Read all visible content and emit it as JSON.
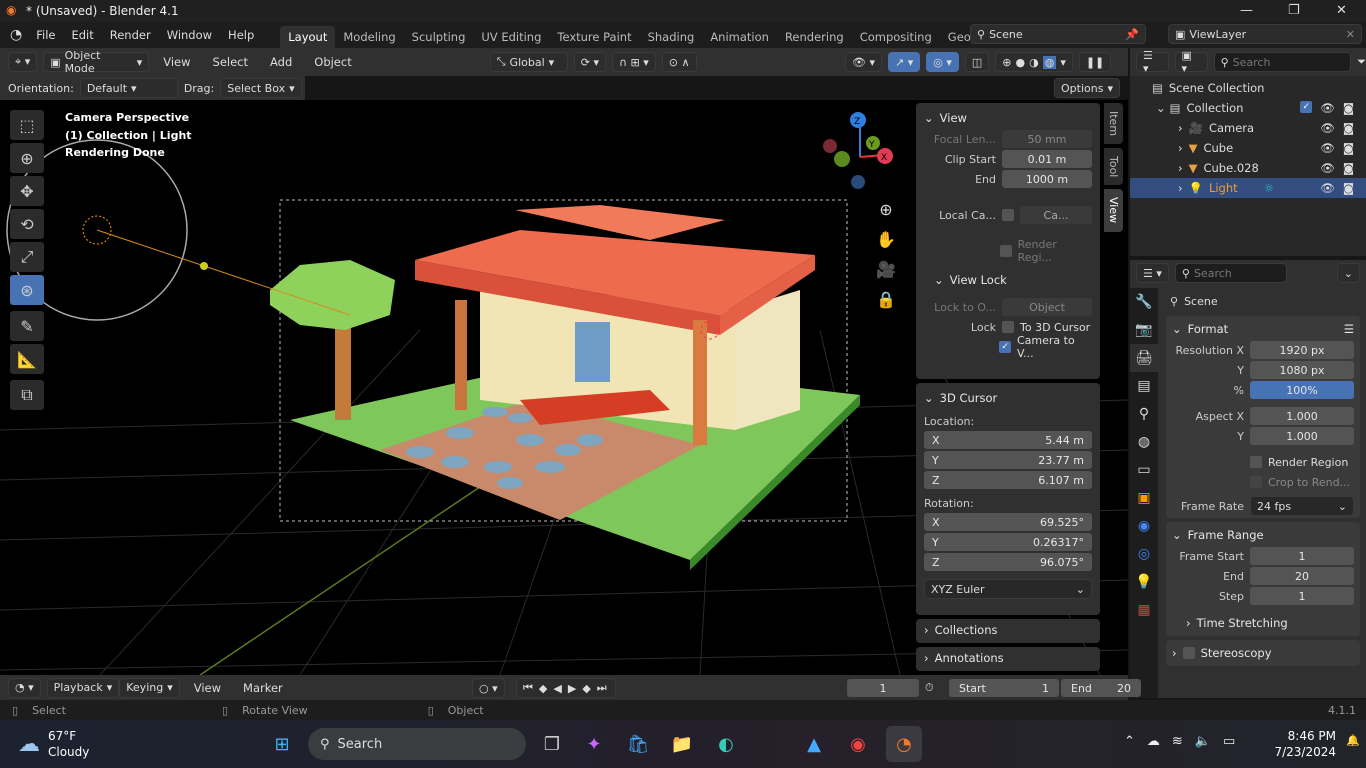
{
  "window": {
    "title": "* (Unsaved) - Blender 4.1"
  },
  "menus": [
    "File",
    "Edit",
    "Render",
    "Window",
    "Help"
  ],
  "workspaces": [
    "Layout",
    "Modeling",
    "Sculpting",
    "UV Editing",
    "Texture Paint",
    "Shading",
    "Animation",
    "Rendering",
    "Compositing",
    "Geomet"
  ],
  "scene": {
    "name": "Scene",
    "view_layer": "ViewLayer"
  },
  "header": {
    "mode": "Object Mode",
    "menus": [
      "View",
      "Select",
      "Add",
      "Object"
    ],
    "transform_orientation": "Global"
  },
  "tool_settings": {
    "orientation_label": "Orientation:",
    "orientation": "Default",
    "drag_label": "Drag:",
    "drag": "Select Box",
    "options": "Options"
  },
  "viewport": {
    "overlay_lines": [
      "Camera Perspective",
      "(1) Collection | Light",
      "Rendering Done"
    ],
    "gizmo_axes": [
      "X",
      "Y",
      "Z"
    ]
  },
  "npanel": {
    "tabs": [
      "Item",
      "Tool",
      "View"
    ],
    "view": {
      "title": "View",
      "focal_label": "Focal Len...",
      "focal": "50 mm",
      "clip_start_label": "Clip Start",
      "clip_start": "0.01 m",
      "end_label": "End",
      "end": "1000 m",
      "local_camera_label": "Local Ca...",
      "local_camera": "Ca...",
      "render_region": "Render Regi...",
      "view_lock": "View Lock",
      "lock_to_label": "Lock to O...",
      "lock_to": "Object",
      "lock_label": "Lock",
      "to_cursor": "To 3D Cursor",
      "camera_to_view": "Camera to V...",
      "camera_to_view_checked": true
    },
    "cursor": {
      "title": "3D Cursor",
      "location_label": "Location:",
      "loc": [
        [
          "X",
          "5.44 m"
        ],
        [
          "Y",
          "23.77 m"
        ],
        [
          "Z",
          "6.107 m"
        ]
      ],
      "rotation_label": "Rotation:",
      "rot": [
        [
          "X",
          "69.525°"
        ],
        [
          "Y",
          "0.26317°"
        ],
        [
          "Z",
          "96.075°"
        ]
      ],
      "mode": "XYZ Euler"
    },
    "collections": "Collections",
    "annotations": "Annotations"
  },
  "outliner": {
    "search_placeholder": "Search",
    "scene_collection": "Scene Collection",
    "collection": "Collection",
    "items": [
      {
        "name": "Camera",
        "icon": "camera-icon"
      },
      {
        "name": "Cube",
        "icon": "mesh-icon"
      },
      {
        "name": "Cube.028",
        "icon": "mesh-icon"
      },
      {
        "name": "Light",
        "icon": "light-icon",
        "selected": true
      }
    ]
  },
  "properties": {
    "search_placeholder": "Search",
    "context": "Scene",
    "format": {
      "title": "Format",
      "res_x_label": "Resolution X",
      "res_x": "1920 px",
      "res_y_label": "Y",
      "res_y": "1080 px",
      "pct_label": "%",
      "pct": "100%",
      "aspect_x_label": "Aspect X",
      "aspect_x": "1.000",
      "aspect_y_label": "Y",
      "aspect_y": "1.000",
      "render_region": "Render Region",
      "crop": "Crop to Rend...",
      "frame_rate_label": "Frame Rate",
      "frame_rate": "24 fps"
    },
    "frame_range": {
      "title": "Frame Range",
      "start_label": "Frame Start",
      "start": "1",
      "end_label": "End",
      "end": "20",
      "step_label": "Step",
      "step": "1",
      "time_stretching": "Time Stretching"
    },
    "stereoscopy": "Stereoscopy"
  },
  "timeline": {
    "menus": [
      "Playback",
      "Keying",
      "View",
      "Marker"
    ],
    "current_frame": "1",
    "start_label": "Start",
    "start": "1",
    "end_label": "End",
    "end": "20"
  },
  "statusbar": {
    "items": [
      "Select",
      "Rotate View",
      "Object"
    ],
    "version": "4.1.1"
  },
  "taskbar": {
    "weather_temp": "67°F",
    "weather_desc": "Cloudy",
    "search": "Search",
    "time": "8:46 PM",
    "date": "7/23/2024"
  },
  "colors": {
    "accent": "#4772b3",
    "selected_row": "#334d80",
    "light_name": "#f0a030"
  }
}
